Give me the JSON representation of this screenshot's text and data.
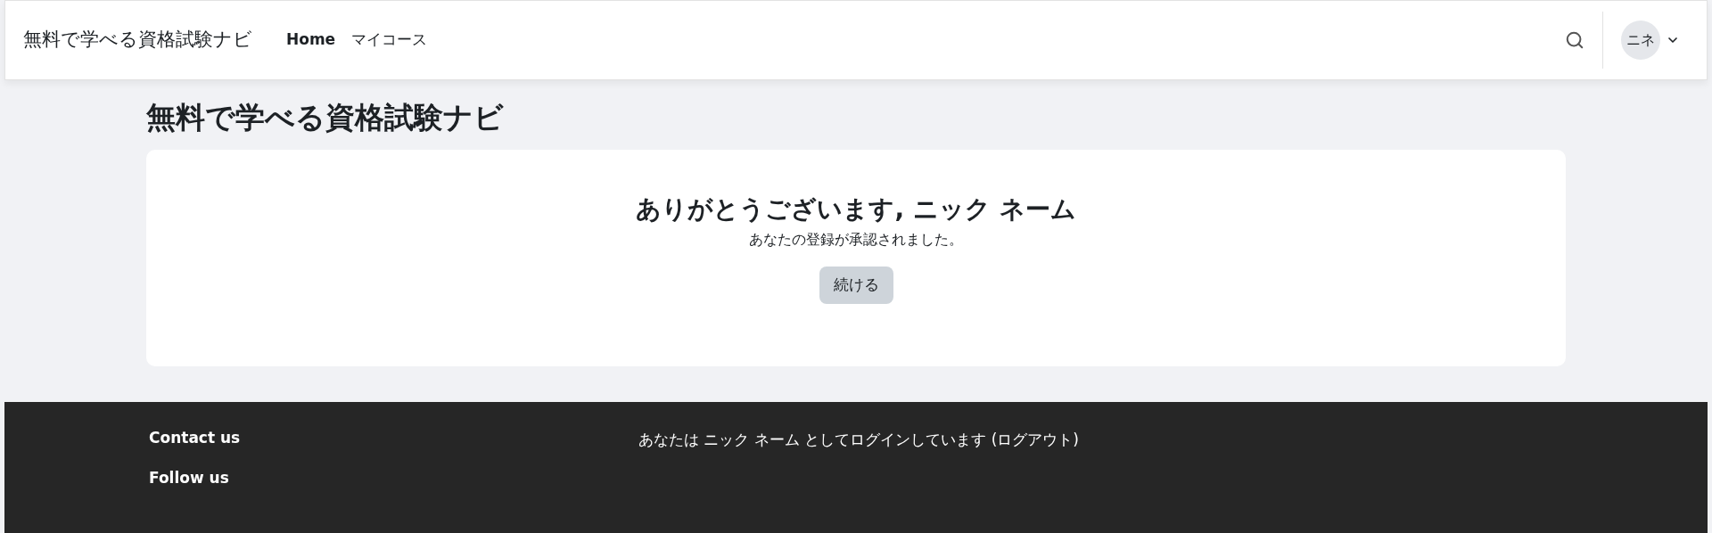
{
  "header": {
    "brand": "無料で学べる資格試験ナビ",
    "nav": [
      {
        "label": "Home",
        "selected": true
      },
      {
        "label": "マイコース",
        "selected": false
      }
    ],
    "avatar": "ニネ"
  },
  "page_title": "無料で学べる資格試験ナビ",
  "card": {
    "heading": "ありがとうございます, ニック ネーム",
    "message": "あなたの登録が承認されました。",
    "button": "続ける"
  },
  "footer": {
    "links": [
      "Contact us",
      "Follow us"
    ],
    "login_text": "あなたは ニック ネーム としてログインしています (ログアウト)"
  }
}
